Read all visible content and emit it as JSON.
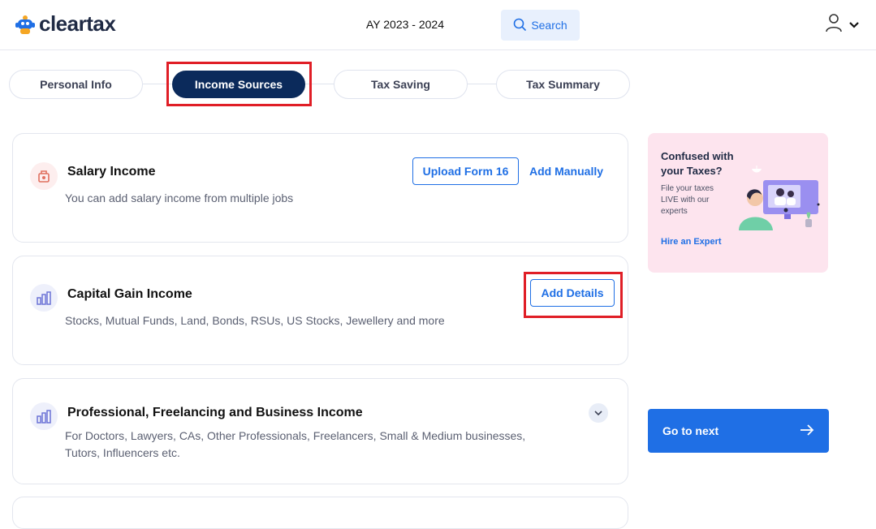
{
  "header": {
    "logo_text": "cleartax",
    "assessment_year": "AY 2023 - 2024",
    "search_label": "Search"
  },
  "steps": [
    {
      "label": "Personal Info",
      "active": false
    },
    {
      "label": "Income Sources",
      "active": true
    },
    {
      "label": "Tax Saving",
      "active": false
    },
    {
      "label": "Tax Summary",
      "active": false
    }
  ],
  "income_sections": {
    "salary": {
      "title": "Salary Income",
      "description": "You can add salary income from multiple jobs",
      "upload_label": "Upload Form 16",
      "manual_label": "Add Manually"
    },
    "capital_gain": {
      "title": "Capital Gain Income",
      "description": "Stocks, Mutual Funds, Land, Bonds, RSUs, US Stocks, Jewellery and more",
      "add_label": "Add Details"
    },
    "professional": {
      "title": "Professional, Freelancing and Business Income",
      "description_line1": "For Doctors, Lawyers, CAs, Other Professionals, Freelancers, Small & Medium businesses,",
      "description_line2": "Tutors, Influencers etc."
    }
  },
  "promo": {
    "title": "Confused with your Taxes?",
    "subtitle": "File your taxes LIVE with our experts",
    "link_label": "Hire an Expert"
  },
  "next_button": {
    "label": "Go to next"
  },
  "colors": {
    "primary_blue": "#1f6fe5",
    "active_step": "#0b2a5b",
    "highlight_red": "#e01e26",
    "promo_bg": "#fde4ee"
  }
}
